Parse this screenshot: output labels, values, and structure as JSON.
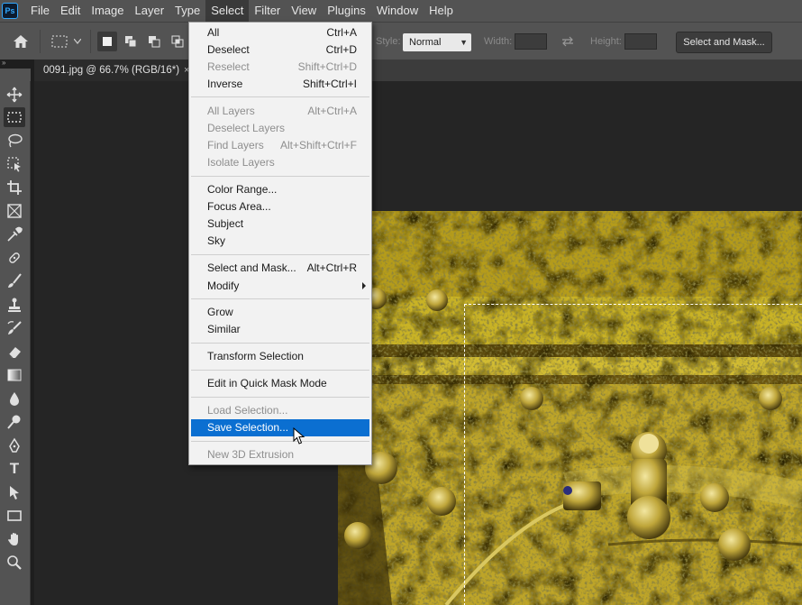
{
  "app": {
    "logo_text": "Ps",
    "menus": [
      "File",
      "Edit",
      "Image",
      "Layer",
      "Type",
      "Select",
      "Filter",
      "View",
      "Plugins",
      "Window",
      "Help"
    ],
    "active_menu": "Select"
  },
  "options_bar": {
    "style_label": "Style:",
    "style_value": "Normal",
    "width_label": "Width:",
    "width_value": "",
    "height_label": "Height:",
    "height_value": "",
    "select_and_mask_button": "Select and Mask..."
  },
  "document_tab": {
    "title": "0091.jpg @ 66.7% (RGB/16*)",
    "close_glyph": "×"
  },
  "toolbar": {
    "collapse_glyph": "»",
    "tools": [
      "move-tool",
      "rectangular-marquee-tool",
      "lasso-tool",
      "object-selection-tool",
      "crop-tool",
      "frame-tool",
      "eyedropper-tool",
      "spot-healing-brush-tool",
      "brush-tool",
      "clone-stamp-tool",
      "history-brush-tool",
      "eraser-tool",
      "gradient-tool",
      "blur-tool",
      "dodge-tool",
      "pen-tool",
      "type-tool",
      "path-selection-tool",
      "rectangle-tool",
      "hand-tool",
      "zoom-tool"
    ],
    "selected_tool": "rectangular-marquee-tool",
    "type_tool_glyph": "T"
  },
  "select_menu": {
    "items": [
      {
        "label": "All",
        "shortcut": "Ctrl+A",
        "disabled": false
      },
      {
        "label": "Deselect",
        "shortcut": "Ctrl+D",
        "disabled": false
      },
      {
        "label": "Reselect",
        "shortcut": "Shift+Ctrl+D",
        "disabled": true
      },
      {
        "label": "Inverse",
        "shortcut": "Shift+Ctrl+I",
        "disabled": false
      },
      {
        "label": "All Layers",
        "shortcut": "Alt+Ctrl+A",
        "disabled": true
      },
      {
        "label": "Deselect Layers",
        "shortcut": "",
        "disabled": true
      },
      {
        "label": "Find Layers",
        "shortcut": "Alt+Shift+Ctrl+F",
        "disabled": true
      },
      {
        "label": "Isolate Layers",
        "shortcut": "",
        "disabled": true
      },
      {
        "label": "Color Range...",
        "shortcut": "",
        "disabled": false
      },
      {
        "label": "Focus Area...",
        "shortcut": "",
        "disabled": false
      },
      {
        "label": "Subject",
        "shortcut": "",
        "disabled": false
      },
      {
        "label": "Sky",
        "shortcut": "",
        "disabled": false
      },
      {
        "label": "Select and Mask...",
        "shortcut": "Alt+Ctrl+R",
        "disabled": false
      },
      {
        "label": "Modify",
        "shortcut": "",
        "disabled": false,
        "submenu": true
      },
      {
        "label": "Grow",
        "shortcut": "",
        "disabled": false
      },
      {
        "label": "Similar",
        "shortcut": "",
        "disabled": false
      },
      {
        "label": "Transform Selection",
        "shortcut": "",
        "disabled": false
      },
      {
        "label": "Edit in Quick Mask Mode",
        "shortcut": "",
        "disabled": false
      },
      {
        "label": "Load Selection...",
        "shortcut": "",
        "disabled": true
      },
      {
        "label": "Save Selection...",
        "shortcut": "",
        "disabled": false,
        "highlighted": true
      },
      {
        "label": "New 3D Extrusion",
        "shortcut": "",
        "disabled": true
      }
    ]
  },
  "colors": {
    "menubar_bg": "#535353",
    "canvas_bg": "#252525",
    "menu_bg": "#f2f2f2",
    "highlight": "#0b6fd1",
    "photo_yellow": "#c9b11c"
  }
}
